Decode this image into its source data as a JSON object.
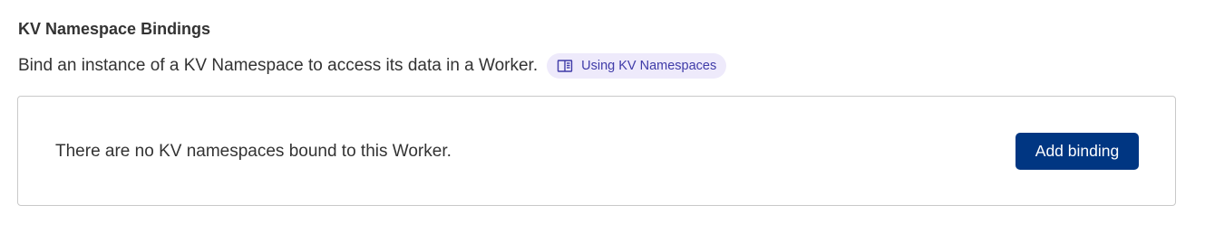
{
  "section": {
    "title": "KV Namespace Bindings",
    "description": "Bind an instance of a KV Namespace to access its data in a Worker.",
    "doc_link": {
      "label": "Using KV Namespaces",
      "icon": "book-icon"
    }
  },
  "bindings_card": {
    "empty_message": "There are no KV namespaces bound to this Worker.",
    "add_button_label": "Add binding"
  },
  "colors": {
    "accent_button": "#003682",
    "pill_background": "#eeeafb",
    "pill_text": "#3f3ba8",
    "border": "#c9c9c9"
  }
}
